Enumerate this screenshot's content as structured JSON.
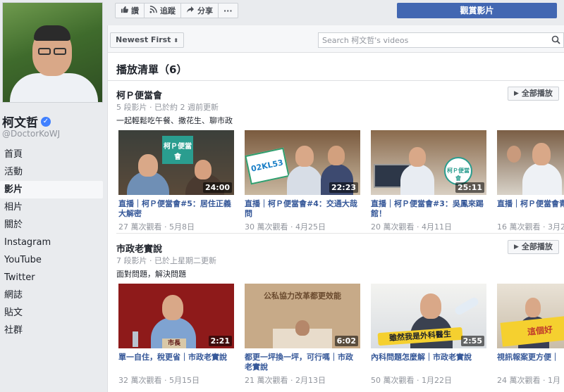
{
  "profile": {
    "name": "柯文哲",
    "handle": "@DoctorKoWJ"
  },
  "nav": [
    {
      "label": "首頁",
      "active": false
    },
    {
      "label": "活動",
      "active": false
    },
    {
      "label": "影片",
      "active": true
    },
    {
      "label": "相片",
      "active": false
    },
    {
      "label": "關於",
      "active": false
    },
    {
      "label": "Instagram",
      "active": false
    },
    {
      "label": "YouTube",
      "active": false
    },
    {
      "label": "Twitter",
      "active": false
    },
    {
      "label": "網誌",
      "active": false
    },
    {
      "label": "貼文",
      "active": false
    },
    {
      "label": "社群",
      "active": false
    }
  ],
  "actions": {
    "like": "讚",
    "follow": "追蹤",
    "share": "分享",
    "more": "···",
    "cta": "觀賞影片"
  },
  "filter": {
    "sort": "Newest First",
    "search_placeholder": "Search 柯文哲's videos"
  },
  "section_title": "播放清單（6）",
  "playlists": [
    {
      "title": "柯Ｐ便當會",
      "meta": "5 段影片 · 已於約 2 週前更新",
      "desc": "一起輕鬆吃午餐、撒花生、聊市政",
      "play_all": "全部播放",
      "videos": [
        {
          "duration": "24:00",
          "title": "直播｜柯Ｐ便當會#5：居住正義大解密",
          "meta": "27 萬次觀看 · 5月8日"
        },
        {
          "duration": "22:23",
          "title": "直播｜柯Ｐ便當會#4：交通大哉問",
          "meta": "30 萬次觀看 · 4月25日"
        },
        {
          "duration": "25:11",
          "title": "直播｜柯Ｐ便當會#3：吳鳳來踢館！",
          "meta": "20 萬次觀看 · 4月11日"
        },
        {
          "duration": "",
          "title": "直播｜柯Ｐ便當會青來了！",
          "meta": "16 萬次觀看 · 3月2"
        }
      ]
    },
    {
      "title": "市政老實說",
      "meta": "7 段影片 · 已於上星期二更新",
      "desc": "面對問題，解決問題",
      "play_all": "全部播放",
      "videos": [
        {
          "duration": "2:21",
          "title": "單一自住，稅更省｜市政老實說",
          "meta": "32 萬次觀看 · 5月15日"
        },
        {
          "duration": "6:02",
          "title": "都更一坪換一坪，可行嗎｜市政老實說",
          "meta": "21 萬次觀看 · 2月13日"
        },
        {
          "duration": "2:55",
          "title": "內科問題怎麼解｜市政老實說",
          "meta": "50 萬次觀看 · 1月22日"
        },
        {
          "duration": "",
          "title": "視訊報案更方便｜",
          "meta": "24 萬次觀看 · 1月"
        }
      ]
    }
  ],
  "thumb_text": {
    "v1_banner": "柯Ｐ便當會",
    "v2_plate": "02KL53",
    "v3_badge": "柯Ｐ便當會",
    "v5_sign": "市長",
    "v6_book": "公私協力改革都更效能",
    "v7_caption": "雖然我是外科醫生",
    "v8_caption": "這個好"
  },
  "colors": {
    "brand": "#4267b2",
    "link": "#365899",
    "meta": "#90949c"
  }
}
